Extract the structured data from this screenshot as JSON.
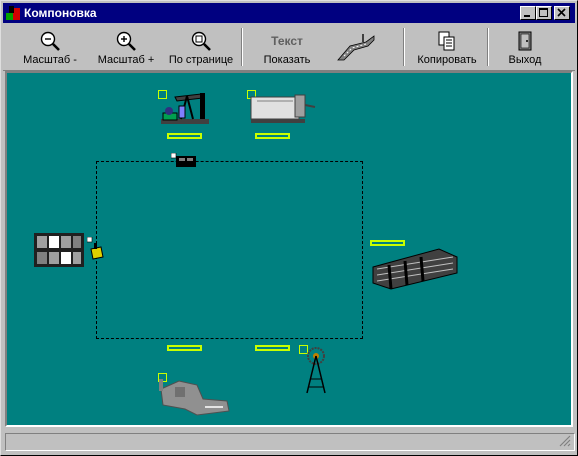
{
  "window": {
    "title": "Компоновка",
    "controls": [
      "minimize-icon",
      "maximize-icon",
      "close-icon"
    ]
  },
  "toolbar": {
    "zoom_out_label": "Масштаб -",
    "zoom_in_label": "Масштаб +",
    "fit_page_label": "По странице",
    "text_big": "Текст",
    "show_label": "Показать",
    "road_icon": "road-icon",
    "copy_label": "Копировать",
    "exit_label": "Выход"
  },
  "colors": {
    "titlebar": "#000080",
    "canvas": "#008080",
    "selection": "#c8ff00",
    "face": "#c0c0c0"
  },
  "canvas": {
    "objects": [
      "pump-jack",
      "tank-truck",
      "generator",
      "control-cabinet",
      "small-valve",
      "pipeline",
      "vise-machine",
      "tower-rig"
    ]
  }
}
